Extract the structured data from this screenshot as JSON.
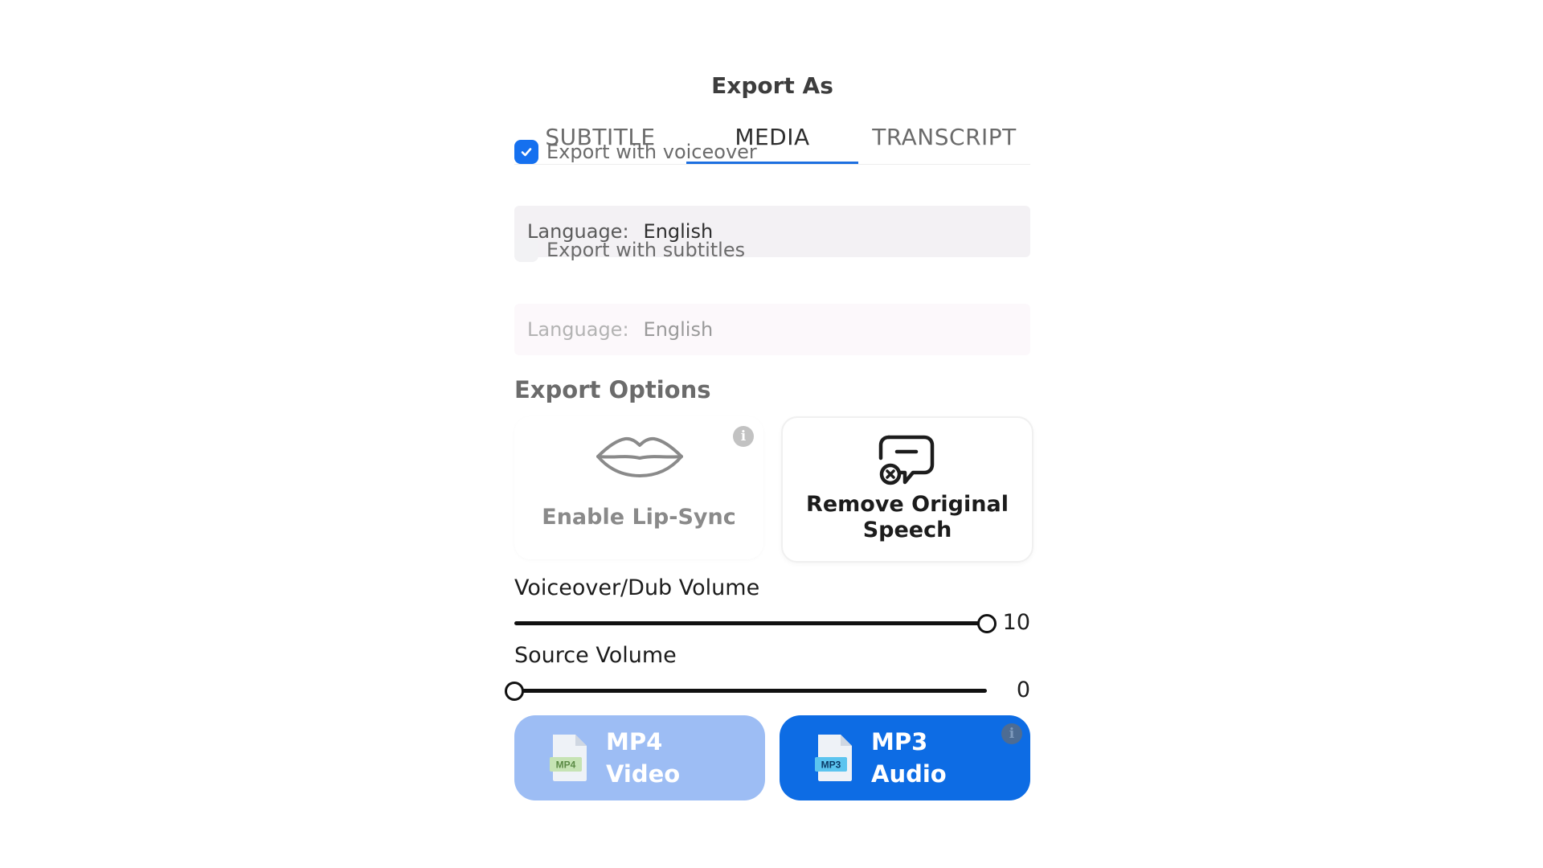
{
  "header": {
    "title": "Export As"
  },
  "tabs": [
    {
      "label": "SUBTITLE",
      "active": false
    },
    {
      "label": "MEDIA",
      "active": true
    },
    {
      "label": "TRANSCRIPT",
      "active": false
    }
  ],
  "voiceover": {
    "checkbox_label": "Export with voiceover",
    "checked": true,
    "language_label": "Language:",
    "language_value": "English"
  },
  "subtitles": {
    "checkbox_label": "Export with subtitles",
    "checked": false,
    "language_label": "Language:",
    "language_value": "English"
  },
  "export_options": {
    "title": "Export Options",
    "lip_sync": {
      "label": "Enable Lip-Sync",
      "icon": "lips-icon"
    },
    "remove_speech": {
      "label": "Remove Original Speech",
      "icon": "speech-bubble-remove-icon"
    }
  },
  "volumes": {
    "voiceover": {
      "label": "Voiceover/Dub Volume",
      "value": "10",
      "fraction": 1.0
    },
    "source": {
      "label": "Source Volume",
      "value": "0",
      "fraction": 0.0
    }
  },
  "formats": {
    "mp4": {
      "badge": "MP4",
      "line1": "MP4",
      "line2": "Video"
    },
    "mp3": {
      "badge": "MP3",
      "line1": "MP3",
      "line2": "Audio"
    }
  },
  "colors": {
    "accent": "#1570ef",
    "primary_button": "#0d6ce4",
    "secondary_button": "#9dbdf4"
  }
}
